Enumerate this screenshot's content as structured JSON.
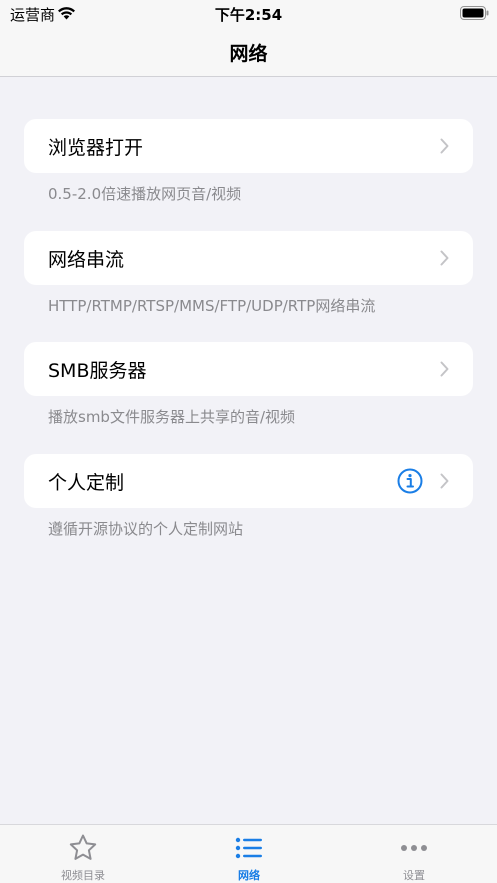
{
  "status_bar": {
    "carrier": "运营商",
    "time": "下午2:54"
  },
  "nav": {
    "title": "网络"
  },
  "sections": [
    {
      "label": "浏览器打开",
      "footer": "0.5-2.0倍速播放网页音/视频"
    },
    {
      "label": "网络串流",
      "footer": "HTTP/RTMP/RTSP/MMS/FTP/UDP/RTP网络串流"
    },
    {
      "label": "SMB服务器",
      "footer": "播放smb文件服务器上共享的音/视频"
    },
    {
      "label": "个人定制",
      "footer": "遵循开源协议的个人定制网站"
    }
  ],
  "tabs": [
    {
      "label": "视频目录",
      "icon": "star-icon"
    },
    {
      "label": "网络",
      "icon": "list-icon"
    },
    {
      "label": "设置",
      "icon": "more-icon"
    }
  ],
  "colors": {
    "accent": "#1a7ee6",
    "background": "#f2f2f7",
    "secondary_text": "#8a8a8e"
  }
}
